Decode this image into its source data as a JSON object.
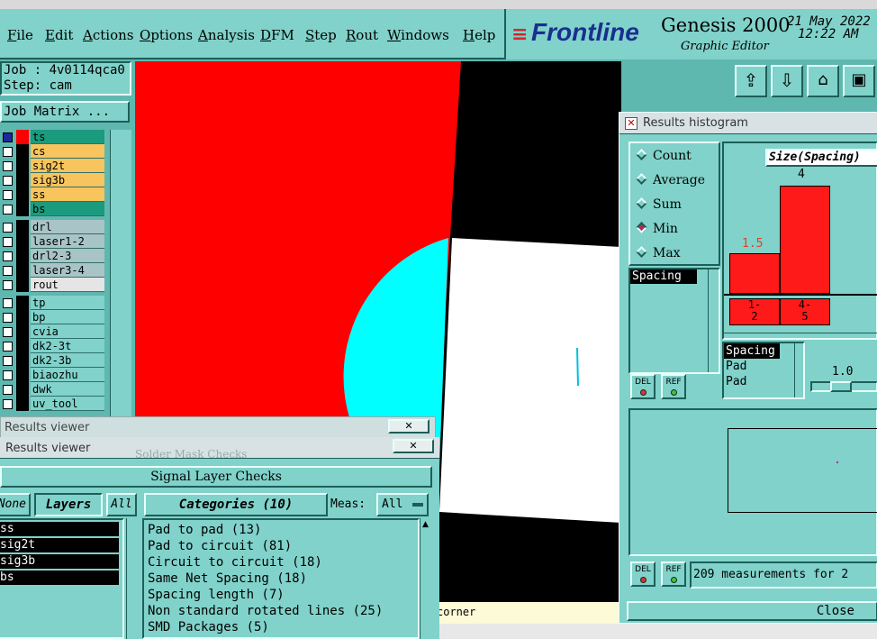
{
  "menu": [
    "File",
    "Edit",
    "Actions",
    "Options",
    "Analysis",
    "DFM",
    "Step",
    "Rout",
    "Windows",
    "Help"
  ],
  "brand": {
    "logo": "Frontline",
    "product": "Genesis 2000",
    "subtitle": "Graphic Editor",
    "date": "21 May 2022",
    "time": "12:22 AM"
  },
  "job": {
    "job_label": "Job : 4v0114qca0",
    "step_label": "Step: cam",
    "matrix_button": "Job Matrix ..."
  },
  "layers": [
    {
      "name": "ts",
      "color": "#1a9b7e"
    },
    {
      "name": "cs",
      "color": "#f7c45e"
    },
    {
      "name": "sig2t",
      "color": "#f7c45e"
    },
    {
      "name": "sig3b",
      "color": "#f7c45e"
    },
    {
      "name": "ss",
      "color": "#f7c45e"
    },
    {
      "name": "bs",
      "color": "#1a9b7e"
    },
    {
      "name": "drl",
      "color": "#a9c4c7"
    },
    {
      "name": "laser1-2",
      "color": "#a9c4c7"
    },
    {
      "name": "drl2-3",
      "color": "#a9c4c7"
    },
    {
      "name": "laser3-4",
      "color": "#a9c4c7"
    },
    {
      "name": "rout",
      "color": "#e5e5e5"
    },
    {
      "name": "tp",
      "color": "#80d2ca"
    },
    {
      "name": "bp",
      "color": "#80d2ca"
    },
    {
      "name": "cvia",
      "color": "#80d2ca"
    },
    {
      "name": "dk2-3t",
      "color": "#80d2ca"
    },
    {
      "name": "dk2-3b",
      "color": "#80d2ca"
    },
    {
      "name": "biaozhu",
      "color": "#80d2ca"
    },
    {
      "name": "dwk",
      "color": "#80d2ca"
    },
    {
      "name": "uv_tool",
      "color": "#80d2ca"
    }
  ],
  "histogram": {
    "title": "Results histogram",
    "modes": [
      {
        "label": "Count",
        "on": false
      },
      {
        "label": "Average",
        "on": false
      },
      {
        "label": "Sum",
        "on": false
      },
      {
        "label": "Min",
        "on": true
      },
      {
        "label": "Max",
        "on": false
      }
    ],
    "size_title": "Size(Spacing)",
    "bars": [
      {
        "range_top": "1-",
        "range_bottom": "2",
        "value": "1.5",
        "height": 1.5
      },
      {
        "range_top": "4-",
        "range_bottom": "5",
        "value": "4",
        "height": 4
      }
    ],
    "list_items": [
      "Spacing"
    ],
    "sub_list": [
      "Spacing",
      "Pad",
      "Pad"
    ],
    "scale_value": "1.0",
    "del_label": "DEL",
    "ref_label": "REF",
    "measurements": "209 measurements for 2",
    "close_label": "Close"
  },
  "results_viewer": {
    "title_back": "Results viewer",
    "title": "Results viewer",
    "ghost_title": "Solder Mask Checks",
    "section_title": "Signal Layer Checks",
    "none_label": "None",
    "layers_label": "Layers",
    "all_label": "All",
    "categories_label": "Categories (10)",
    "meas_label": "Meas:",
    "meas_value": "All",
    "layer_list": [
      "ss",
      "sig2t",
      "sig3b",
      "bs"
    ],
    "categories": [
      "Pad to pad (13)",
      "Pad to circuit (81)",
      "Circuit to circuit (18)",
      "Same Net Spacing (18)",
      "Spacing length (7)",
      "Non standard rotated lines (25)",
      "SMD Packages (5)"
    ]
  },
  "status": {
    "corner_text": "corner"
  }
}
